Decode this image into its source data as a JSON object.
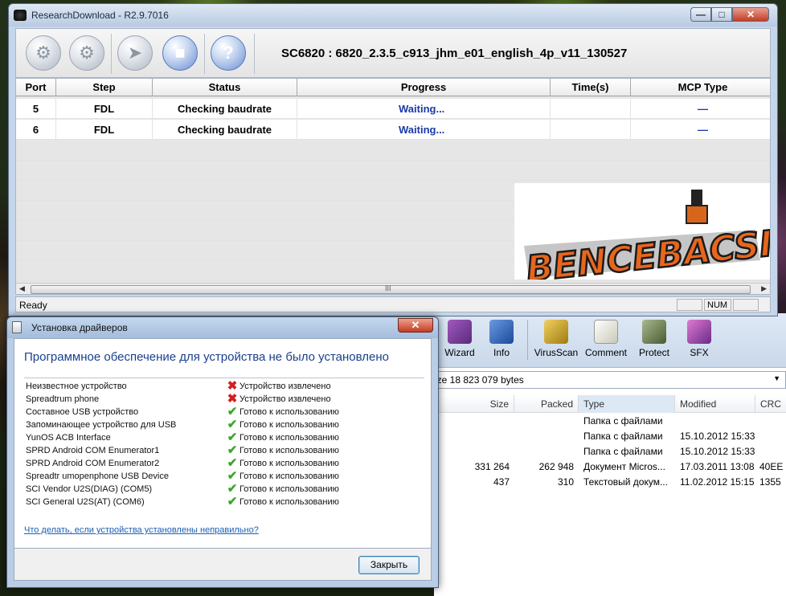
{
  "rd": {
    "title": "ResearchDownload - R2.9.7016",
    "firmware": "SC6820 : 6820_2.3.5_c913_jhm_e01_english_4p_v11_130527",
    "columns": [
      "Port",
      "Step",
      "Status",
      "Progress",
      "Time(s)",
      "MCP Type"
    ],
    "rows": [
      {
        "port": "5",
        "step": "FDL",
        "status": "Checking baudrate",
        "progress": "Waiting...",
        "time": "",
        "mcp": "—"
      },
      {
        "port": "6",
        "step": "FDL",
        "status": "Checking baudrate",
        "progress": "Waiting...",
        "time": "",
        "mcp": "—"
      }
    ],
    "status_text": "Ready",
    "num_indicator": "NUM",
    "logo_text": "BENCEBACSI",
    "scroll_grip": "III",
    "buttons": {
      "min": "—",
      "max": "□",
      "close": "✕"
    },
    "toolbar_glyphs": {
      "load": "⚙",
      "settings": "⚙",
      "start": "➤",
      "stop": "■",
      "help": "?"
    }
  },
  "dialog": {
    "title": "Установка драйверов",
    "close_glyph": "✕",
    "heading": "Программное обеспечение для устройства не было установлено",
    "devices": [
      {
        "name": "Неизвестное устройство",
        "icon": "error-x",
        "status": "Устройство извлечено"
      },
      {
        "name": "Spreadtrum phone",
        "icon": "error-x",
        "status": "Устройство извлечено"
      },
      {
        "name": "Составное USB устройство",
        "icon": "check",
        "status": "Готово к использованию"
      },
      {
        "name": "Запоминающее устройство для USB",
        "icon": "check",
        "status": "Готово к использованию"
      },
      {
        "name": "YunOS ACB Interface",
        "icon": "check",
        "status": "Готово к использованию"
      },
      {
        "name": "SPRD Android COM Enumerator1",
        "icon": "check",
        "status": "Готово к использованию"
      },
      {
        "name": "SPRD Android COM Enumerator2",
        "icon": "check",
        "status": "Готово к использованию"
      },
      {
        "name": "Spreadtr umopenphone USB Device",
        "icon": "check",
        "status": "Готово к использованию"
      },
      {
        "name": "SCI Vendor U2S(DIAG) (COM5)",
        "icon": "check",
        "status": "Готово к использованию"
      },
      {
        "name": "SCI General U2S(AT) (COM6)",
        "icon": "check",
        "status": "Готово к использованию"
      }
    ],
    "help_link": "Что делать, если устройства установлены неправильно?",
    "close_button": "Закрыть"
  },
  "rar": {
    "tools": [
      {
        "label": "Wizard",
        "icon": "wizard-icon",
        "color": "#7a3a9a"
      },
      {
        "label": "Info",
        "icon": "info-icon",
        "color": "#2a5aa8"
      },
      {
        "label": "VirusScan",
        "icon": "virusscan-icon",
        "color": "#c8a020"
      },
      {
        "label": "Comment",
        "icon": "comment-icon",
        "color": "#e0e0d0"
      },
      {
        "label": "Protect",
        "icon": "protect-icon",
        "color": "#6a7a50"
      },
      {
        "label": "SFX",
        "icon": "sfx-icon",
        "color": "#b04aa0"
      }
    ],
    "path_text": "ize 18 823 079 bytes",
    "columns": [
      "Size",
      "Packed",
      "Type",
      "Modified",
      "CRC"
    ],
    "rows": [
      {
        "size": "",
        "packed": "",
        "type": "Папка с файлами",
        "modified": "",
        "crc": ""
      },
      {
        "size": "",
        "packed": "",
        "type": "Папка с файлами",
        "modified": "15.10.2012 15:33",
        "crc": ""
      },
      {
        "size": "",
        "packed": "",
        "type": "Папка с файлами",
        "modified": "15.10.2012 15:33",
        "crc": ""
      },
      {
        "size": "331 264",
        "packed": "262 948",
        "type": "Документ Micros...",
        "modified": "17.03.2011 13:08",
        "crc": "40EE"
      },
      {
        "size": "437",
        "packed": "310",
        "type": "Текстовый докум...",
        "modified": "11.02.2012 15:15",
        "crc": "1355"
      }
    ]
  }
}
